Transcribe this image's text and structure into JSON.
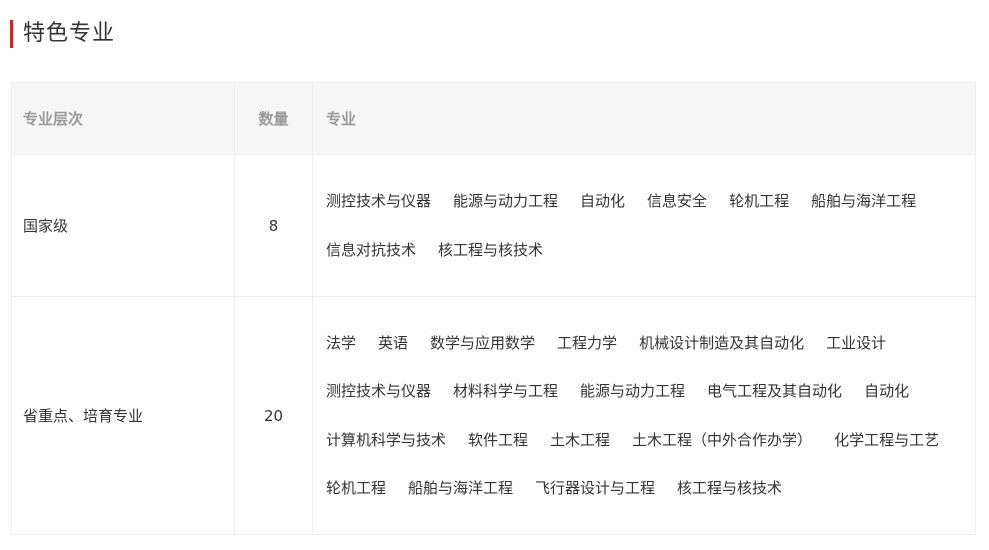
{
  "section": {
    "title": "特色专业"
  },
  "table": {
    "headers": {
      "level": "专业层次",
      "count": "数量",
      "majors": "专业"
    },
    "rows": [
      {
        "level": "国家级",
        "count": "8",
        "majors": [
          "测控技术与仪器",
          "能源与动力工程",
          "自动化",
          "信息安全",
          "轮机工程",
          "船舶与海洋工程",
          "信息对抗技术",
          "核工程与核技术"
        ]
      },
      {
        "level": "省重点、培育专业",
        "count": "20",
        "majors": [
          "法学",
          "英语",
          "数学与应用数学",
          "工程力学",
          "机械设计制造及其自动化",
          "工业设计",
          "测控技术与仪器",
          "材料科学与工程",
          "能源与动力工程",
          "电气工程及其自动化",
          "自动化",
          "计算机科学与技术",
          "软件工程",
          "土木工程",
          "土木工程（中外合作办学）",
          "化学工程与工艺",
          "轮机工程",
          "船舶与海洋工程",
          "飞行器设计与工程",
          "核工程与核技术"
        ]
      }
    ]
  },
  "colors": {
    "accent": "#c8282d",
    "header_bg": "#f6f6f6",
    "header_text": "#999999",
    "border": "#eeeeee",
    "body_text": "#333333"
  }
}
